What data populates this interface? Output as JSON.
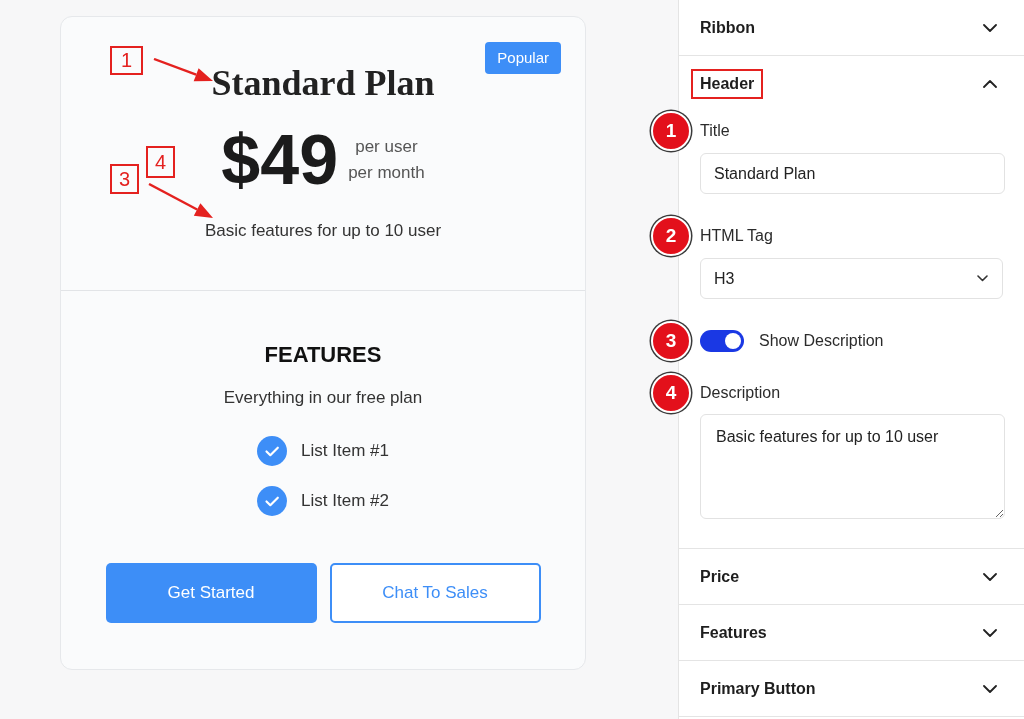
{
  "pricing_card": {
    "ribbon": "Popular",
    "title": "Standard Plan",
    "title_callouts": [
      "1"
    ],
    "price": "$49",
    "price_period": [
      "per user",
      "per month"
    ],
    "description": "Basic features for up to 10 user",
    "description_callouts": [
      "3",
      "4"
    ],
    "features": {
      "heading": "FEATURES",
      "subheading": "Everything in our free plan",
      "items": [
        "List Item #1",
        "List Item #2"
      ]
    },
    "buttons": [
      {
        "label": "Get Started",
        "kind": "primary"
      },
      {
        "label": "Chat To Sales",
        "kind": "outline"
      }
    ]
  },
  "settings_panel": {
    "sections": [
      {
        "title": "Ribbon",
        "expanded": false,
        "highlighted": false
      },
      {
        "title": "Header",
        "expanded": true,
        "highlighted": true,
        "fields": [
          {
            "kind": "text",
            "badge": "1",
            "label": "Title",
            "value": "Standard Plan"
          },
          {
            "kind": "select",
            "badge": "2",
            "label": "HTML Tag",
            "value": "H3"
          },
          {
            "kind": "toggle",
            "badge": "3",
            "label": "Show Description",
            "on": true
          },
          {
            "kind": "textarea",
            "badge": "4",
            "label": "Description",
            "value": "Basic features for up to 10 user"
          }
        ]
      },
      {
        "title": "Price",
        "expanded": false,
        "highlighted": false
      },
      {
        "title": "Features",
        "expanded": false,
        "highlighted": false
      },
      {
        "title": "Primary Button",
        "expanded": false,
        "highlighted": false
      }
    ]
  }
}
